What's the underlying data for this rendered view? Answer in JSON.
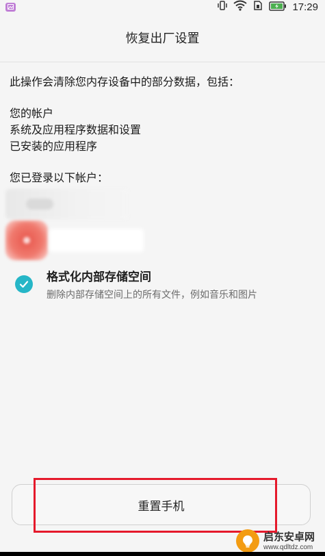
{
  "status_bar": {
    "time": "17:29",
    "icons": [
      "gallery-icon",
      "vibrate-icon",
      "wifi-icon",
      "sim-icon",
      "battery-charging-icon"
    ],
    "battery_color": "#4caf50"
  },
  "header": {
    "title": "恢复出厂设置"
  },
  "content": {
    "intro": "此操作会清除您内存设备中的部分数据，包括：",
    "erase_items": [
      "您的帐户",
      "系统及应用程序数据和设置",
      "已安装的应用程序"
    ],
    "accounts_label": "您已登录以下帐户："
  },
  "format_option": {
    "checked": true,
    "title": "格式化内部存储空间",
    "description": "删除内部存储空间上的所有文件，例如音乐和图片",
    "accent_color": "#26b6c7"
  },
  "reset_button": {
    "label": "重置手机"
  },
  "watermark": {
    "title": "启东安卓网",
    "url": "www.qdltdz.com"
  },
  "colors": {
    "highlight": "#e5192b",
    "background": "#f5f5f5"
  }
}
